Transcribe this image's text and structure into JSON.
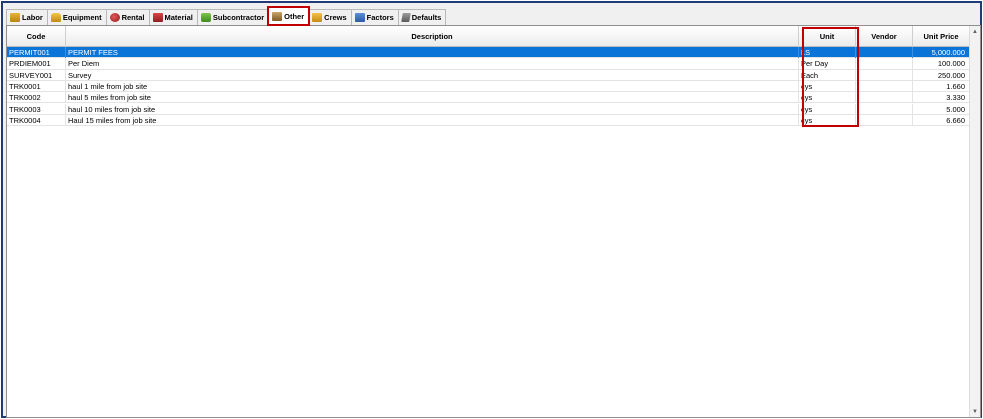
{
  "tabs": [
    {
      "label": "Labor",
      "icon": "labor-icon"
    },
    {
      "label": "Equipment",
      "icon": "equipment-icon"
    },
    {
      "label": "Rental",
      "icon": "rental-icon"
    },
    {
      "label": "Material",
      "icon": "material-icon"
    },
    {
      "label": "Subcontractor",
      "icon": "subcontractor-icon"
    },
    {
      "label": "Other",
      "icon": "other-icon"
    },
    {
      "label": "Crews",
      "icon": "crews-icon"
    },
    {
      "label": "Factors",
      "icon": "factors-icon"
    },
    {
      "label": "Defaults",
      "icon": "defaults-icon"
    }
  ],
  "active_tab": "Other",
  "columns": {
    "code": "Code",
    "description": "Description",
    "unit": "Unit",
    "vendor": "Vendor",
    "unit_price": "Unit Price"
  },
  "rows": [
    {
      "code": "PERMIT001",
      "description": "PERMIT FEES",
      "unit": "LS",
      "vendor": "",
      "unit_price": "5,000.000"
    },
    {
      "code": "PRDIEM001",
      "description": "Per Diem",
      "unit": "Per Day",
      "vendor": "",
      "unit_price": "100.000"
    },
    {
      "code": "SURVEY001",
      "description": "Survey",
      "unit": "Each",
      "vendor": "",
      "unit_price": "250.000"
    },
    {
      "code": "TRK0001",
      "description": "haul 1 mile from job site",
      "unit": "cys",
      "vendor": "",
      "unit_price": "1.660"
    },
    {
      "code": "TRK0002",
      "description": "haul 5 miles from job site",
      "unit": "cys",
      "vendor": "",
      "unit_price": "3.330"
    },
    {
      "code": "TRK0003",
      "description": "haul 10 miles from job site",
      "unit": "cys",
      "vendor": "",
      "unit_price": "5.000"
    },
    {
      "code": "TRK0004",
      "description": "Haul 15 miles from job site",
      "unit": "cys",
      "vendor": "",
      "unit_price": "6.660"
    }
  ],
  "selected_row": 0,
  "colors": {
    "selection": "#0a74d8",
    "highlight": "#c00000",
    "frame": "#1f3c78"
  },
  "scrollbar": {
    "up_icon": "scroll-up-icon",
    "down_icon": "scroll-down-icon"
  }
}
